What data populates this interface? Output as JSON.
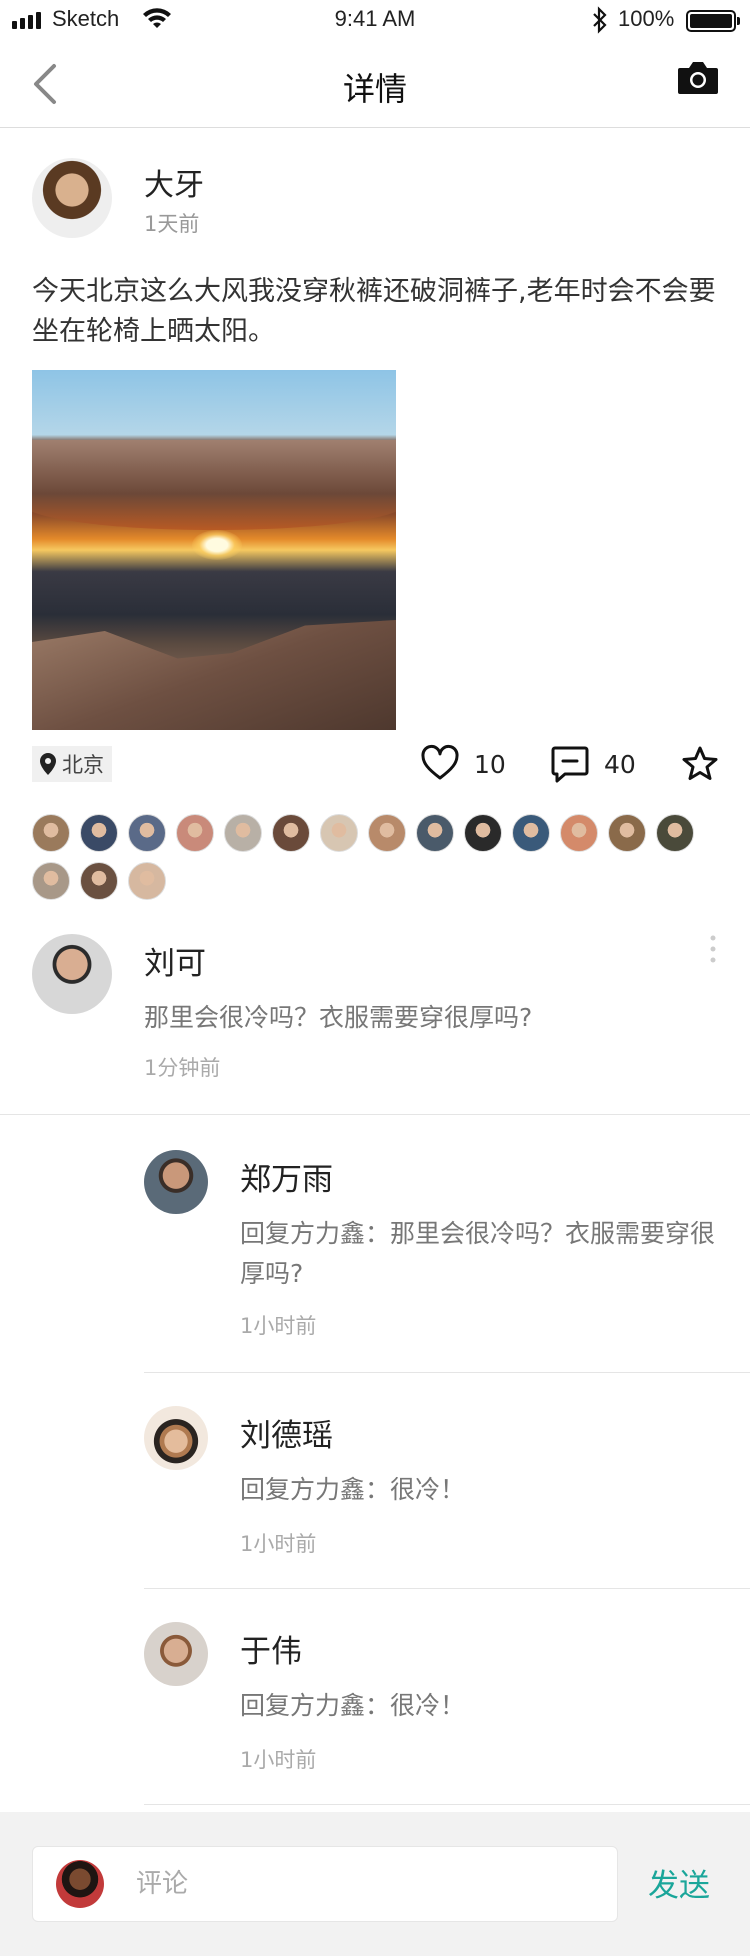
{
  "status_bar": {
    "carrier": "Sketch",
    "time": "9:41 AM",
    "battery": "100%"
  },
  "nav": {
    "title": "详情",
    "back_icon": "chevron-left-icon",
    "camera_icon": "camera-icon"
  },
  "post": {
    "author": "大牙",
    "time": "1天前",
    "text": "今天北京这么大风我没穿秋裤还破洞裤子,老年时会不会要坐在轮椅上晒太阳。",
    "location": "北京",
    "likes": "10",
    "comments": "40"
  },
  "likers": {
    "count": 17,
    "colors": [
      "#9a7a5c",
      "#3a4a66",
      "#5a6a88",
      "#c98a7a",
      "#b8b0a6",
      "#6a4a3a",
      "#d7c6b2",
      "#b88a6a",
      "#4a5a6a",
      "#2a2a2a",
      "#3a5a7a",
      "#d48a6a",
      "#8a6a4a",
      "#4a4a3a",
      "#a89888",
      "#6a5040",
      "#d6b8a0"
    ]
  },
  "comment": {
    "name": "刘可",
    "text": "那里会很冷吗？衣服需要穿很厚吗?",
    "time": "1分钟前"
  },
  "replies": [
    {
      "name": "郑万雨",
      "text": "回复方力鑫：那里会很冷吗？衣服需要穿很厚吗?",
      "time": "1小时前",
      "color": "#6a5a4e"
    },
    {
      "name": "刘德瑶",
      "text": "回复方力鑫：很冷！",
      "time": "1小时前",
      "color": "#d8b090"
    },
    {
      "name": "于伟",
      "text": "回复方力鑫：很冷！",
      "time": "1小时前",
      "color": "#c9a48a"
    }
  ],
  "composer": {
    "placeholder": "评论",
    "send_label": "发送",
    "accent": "#1aa69a"
  }
}
